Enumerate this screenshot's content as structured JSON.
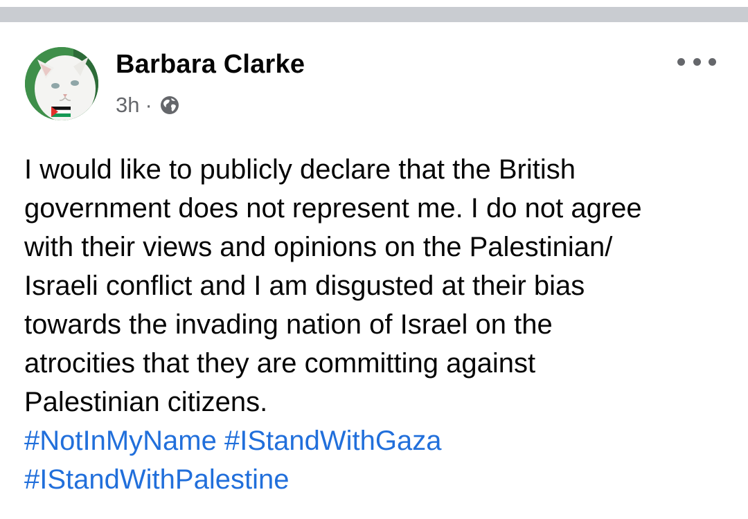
{
  "post": {
    "author_name": "Barbara Clarke",
    "timestamp": "3h",
    "separator": "·",
    "privacy_icon": "globe-icon",
    "more_icon": "more-options-icon",
    "body_lines": [
      "I would like to publicly declare that the British",
      "government does not represent me. I do not agree",
      "with their views and opinions on the Palestinian/",
      "Israeli conflict and I am disgusted at their bias",
      "towards the invading nation of Israel on the",
      "atrocities that they are committing against",
      "Palestinian citizens."
    ],
    "hashtags": [
      "#NotInMyName",
      "#IStandWithGaza",
      "#IStandWithPalestine"
    ]
  },
  "colors": {
    "divider": "#c9ccd1",
    "text_primary": "#050505",
    "text_secondary": "#65676b",
    "hashtag": "#216fdb"
  }
}
